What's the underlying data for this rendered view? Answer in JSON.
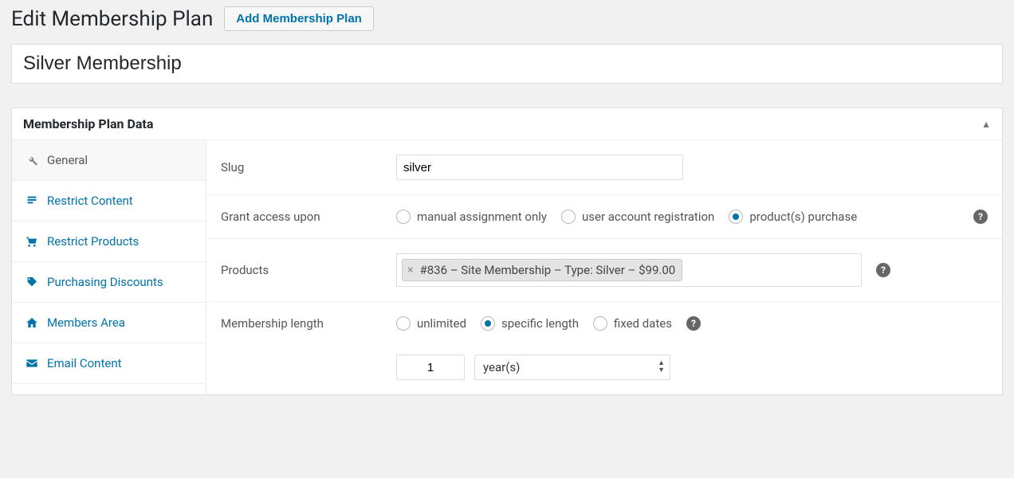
{
  "header": {
    "title": "Edit Membership Plan",
    "add_button": "Add Membership Plan"
  },
  "post_title": "Silver Membership",
  "panel": {
    "title": "Membership Plan Data",
    "tabs": {
      "general": "General",
      "restrict_content": "Restrict Content",
      "restrict_products": "Restrict Products",
      "purchasing_discounts": "Purchasing Discounts",
      "members_area": "Members Area",
      "email_content": "Email Content"
    }
  },
  "form": {
    "slug_label": "Slug",
    "slug_value": "silver",
    "grant_label": "Grant access upon",
    "grant_options": {
      "manual": "manual assignment only",
      "registration": "user account registration",
      "purchase": "product(s) purchase"
    },
    "products_label": "Products",
    "product_chip": "#836 – Site Membership – Type: Silver – $99.00",
    "length_label": "Membership length",
    "length_options": {
      "unlimited": "unlimited",
      "specific": "specific length",
      "fixed": "fixed dates"
    },
    "length_value": "1",
    "length_unit": "year(s)"
  }
}
